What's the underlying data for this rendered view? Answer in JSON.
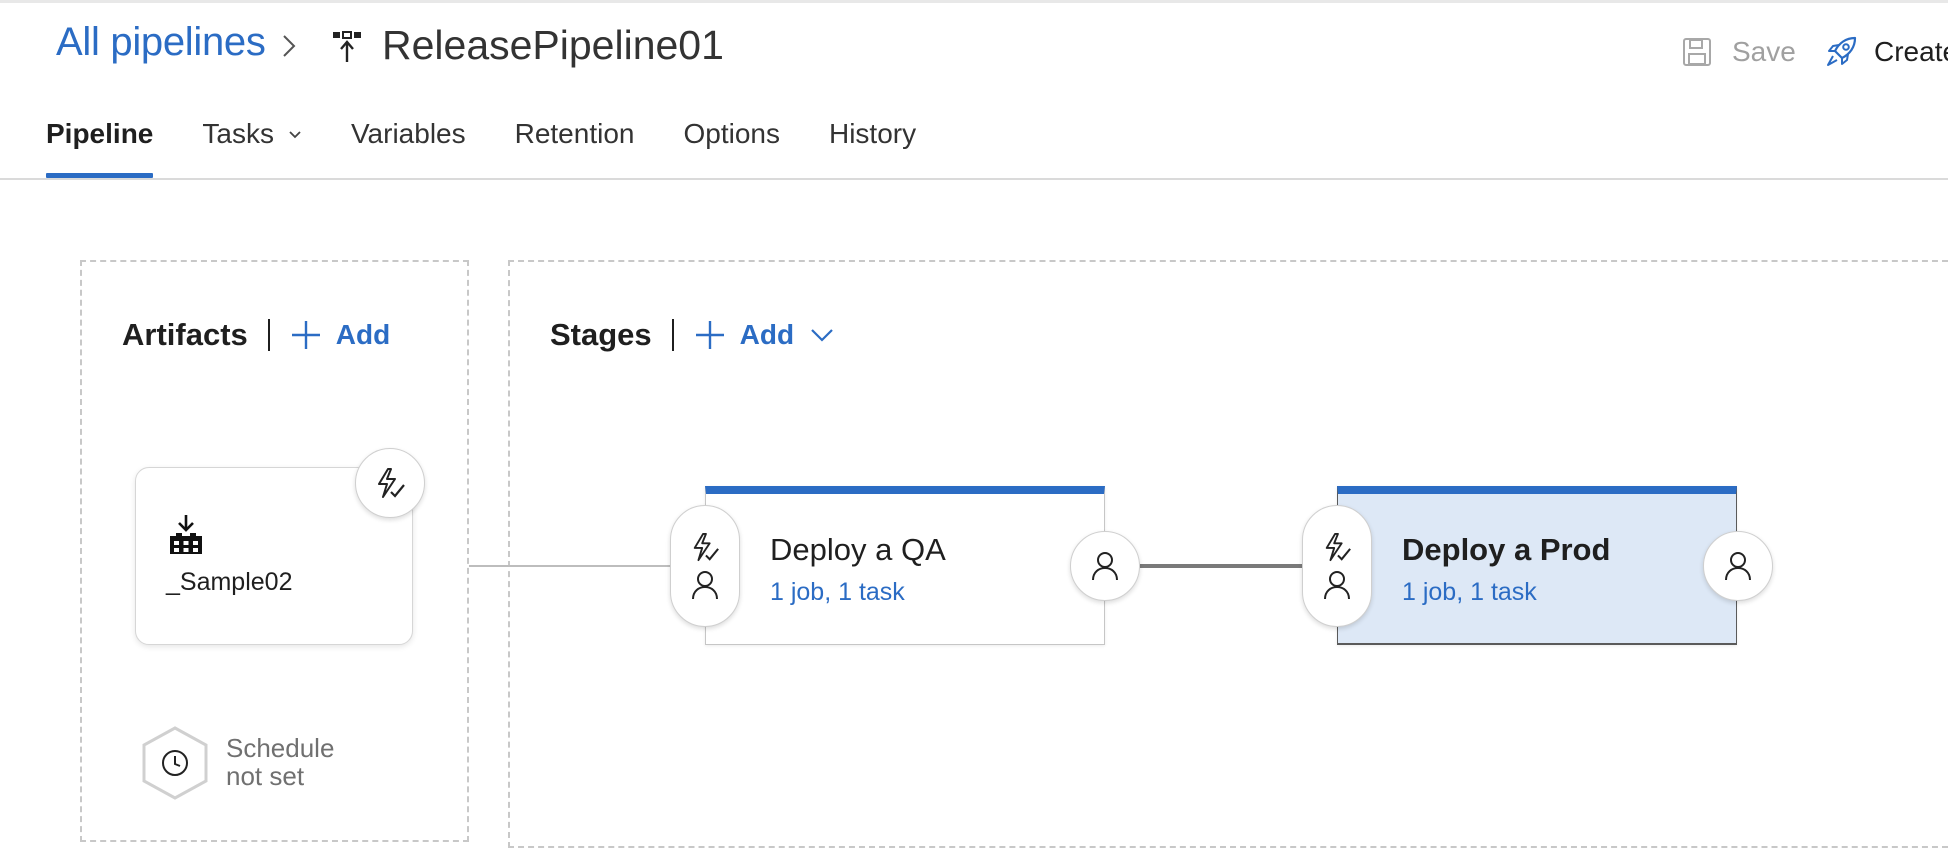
{
  "header": {
    "breadcrumb_root": "All pipelines",
    "pipeline_title": "ReleasePipeline01",
    "save_label": "Save",
    "create_label": "Create"
  },
  "tabs": [
    {
      "label": "Pipeline",
      "active": true
    },
    {
      "label": "Tasks",
      "active": false
    },
    {
      "label": "Variables",
      "active": false
    },
    {
      "label": "Retention",
      "active": false
    },
    {
      "label": "Options",
      "active": false
    },
    {
      "label": "History",
      "active": false
    }
  ],
  "artifacts": {
    "title": "Artifacts",
    "add_label": "Add",
    "items": [
      {
        "name": "_Sample02",
        "icon": "build-artifact-icon"
      }
    ],
    "schedule": {
      "line1": "Schedule",
      "line2": "not set",
      "icon": "clock-icon"
    }
  },
  "stages": {
    "title": "Stages",
    "add_label": "Add",
    "items": [
      {
        "name": "Deploy a QA",
        "summary": "1 job, 1 task",
        "selected": false
      },
      {
        "name": "Deploy a Prod",
        "summary": "1 job, 1 task",
        "selected": true
      }
    ]
  },
  "colors": {
    "accent": "#2b6cc4",
    "selected_stage_bg": "#dde8f6",
    "muted_text": "#707070"
  }
}
